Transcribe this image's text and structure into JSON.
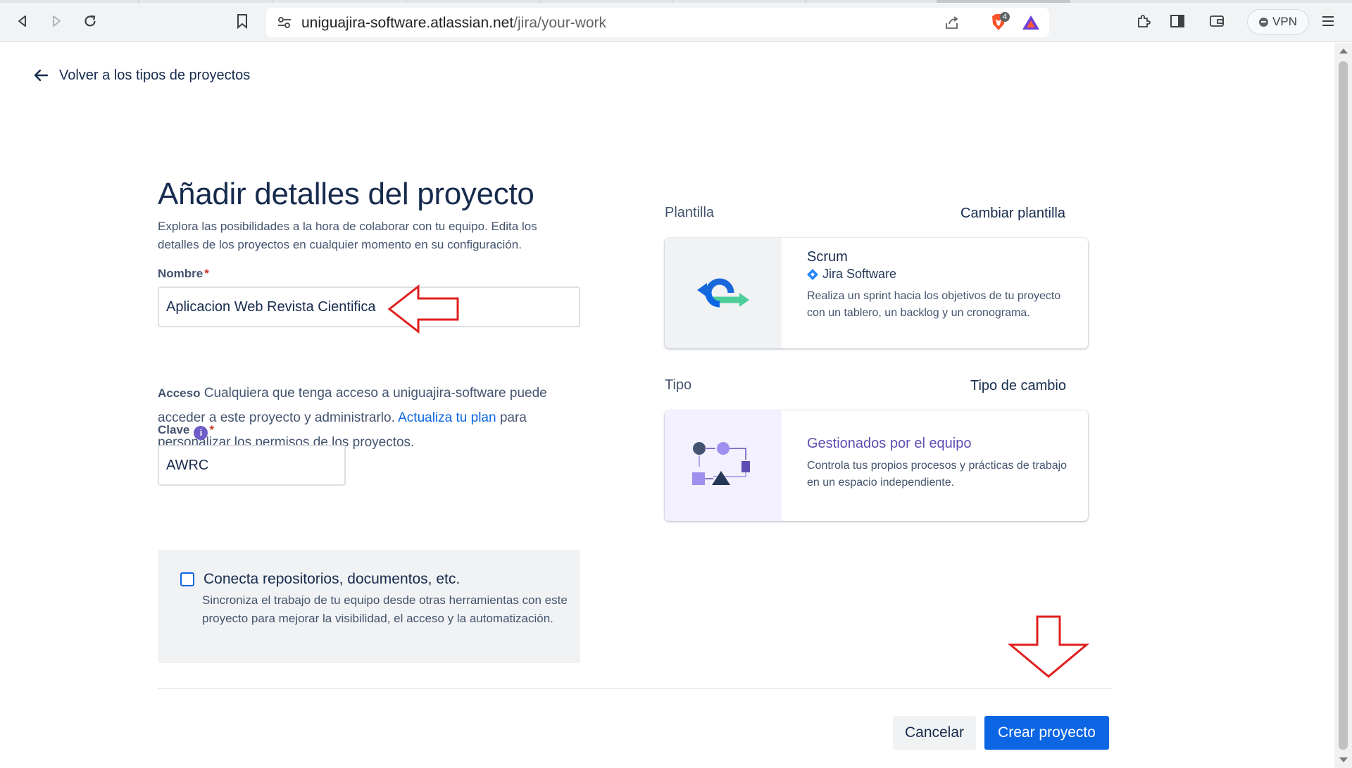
{
  "browser": {
    "url_host": "uniguajira-software.atlassian.net",
    "url_path": "/jira/your-work",
    "extension_badge": "4",
    "vpn_label": "VPN"
  },
  "page": {
    "back_link": "Volver a los tipos de proyectos",
    "title": "Añadir detalles del proyecto",
    "subtitle": "Explora las posibilidades a la hora de colaborar con tu equipo. Edita los detalles de los proyectos en cualquier momento en su configuración.",
    "name_field": {
      "label": "Nombre",
      "required_mark": "*",
      "value": "Aplicacion Web Revista Cientifica"
    },
    "access": {
      "label": "Acceso",
      "text_before_link": "Cualquiera que tenga acceso a uniguajira-software puede acceder a este proyecto y administrarlo.",
      "link": "Actualiza tu plan",
      "text_after_link": "para personalizar los permisos de los proyectos."
    },
    "key_field": {
      "label": "Clave",
      "info_glyph": "i",
      "required_mark": "*",
      "value": "AWRC"
    },
    "connect": {
      "title": "Conecta repositorios, documentos, etc.",
      "description": "Sincroniza el trabajo de tu equipo desde otras herramientas con este proyecto para mejorar la visibilidad, el acceso y la automatización.",
      "checked": false
    },
    "template": {
      "section_label": "Plantilla",
      "action": "Cambiar plantilla",
      "card_title": "Scrum",
      "card_brand": "Jira Software",
      "card_description": "Realiza un sprint hacia los objetivos de tu proyecto con un tablero, un backlog y un cronograma."
    },
    "type": {
      "section_label": "Tipo",
      "action": "Tipo de cambio",
      "card_title": "Gestionados por el equipo",
      "card_description": "Controla tus propios procesos y prácticas de trabajo en un espacio independiente."
    },
    "buttons": {
      "cancel": "Cancelar",
      "create": "Crear proyecto"
    }
  },
  "colors": {
    "primary": "#0c66e4",
    "text": "#172b4d",
    "subtle_text": "#44546f",
    "purple": "#5e4db2",
    "annotation_red": "#e01f1f"
  },
  "icons": [
    "back-icon",
    "forward-icon",
    "reload-icon",
    "bookmark-icon",
    "site-settings-icon",
    "share-icon",
    "brave-shield-icon",
    "brave-rewards-icon",
    "extensions-icon",
    "sidebar-icon",
    "wallet-icon",
    "menu-icon",
    "arrow-left-icon",
    "info-icon",
    "scrum-icon",
    "jira-diamond-icon",
    "team-managed-icon"
  ]
}
